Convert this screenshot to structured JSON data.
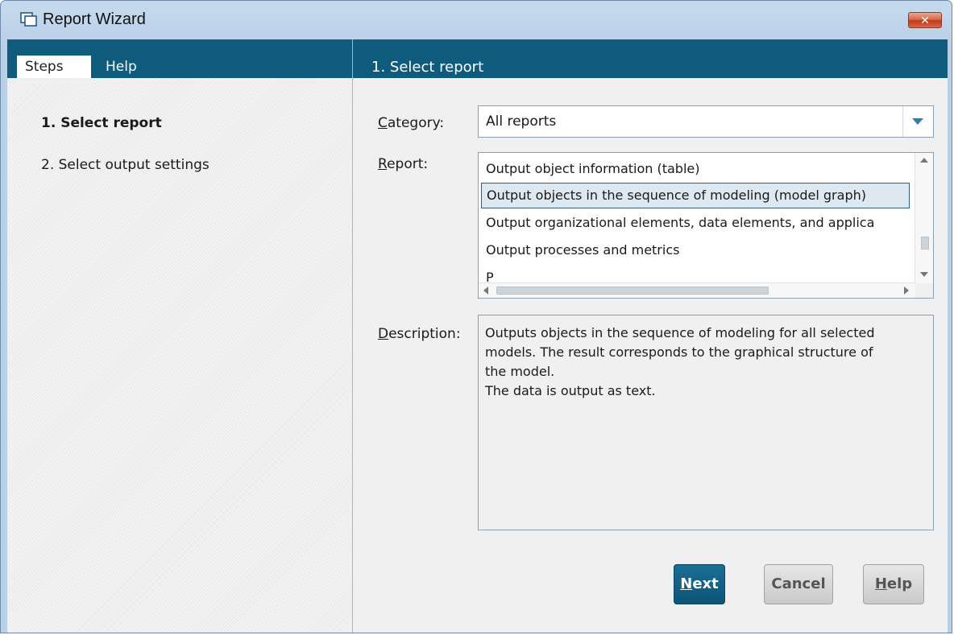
{
  "window": {
    "title": "Report Wizard",
    "close_symbol": "✕",
    "icon": "window-icon"
  },
  "left_panel": {
    "tabs": [
      {
        "label": "Steps",
        "active": true
      },
      {
        "label": "Help",
        "active": false
      }
    ],
    "steps": [
      {
        "label": "1. Select report",
        "active": true
      },
      {
        "label": "2. Select output settings",
        "active": false
      }
    ]
  },
  "right_panel": {
    "header": "1. Select report",
    "category": {
      "label_mnemonic": "C",
      "label_rest": "ategory:",
      "value": "All reports"
    },
    "report": {
      "label_mnemonic": "R",
      "label_rest": "eport:",
      "items": [
        "Output object information (table)",
        "Output objects in the sequence of modeling (model graph)",
        "Output organizational elements, data elements, and applica",
        "Output processes and metrics",
        "P"
      ],
      "selected_index": 1
    },
    "description": {
      "label_mnemonic": "D",
      "label_rest": "escription:",
      "text": "Outputs objects in the sequence of modeling for all selected\nmodels. The result corresponds to the graphical structure of\nthe model.\nThe data is output as text."
    }
  },
  "buttons": {
    "next": {
      "mnemonic": "N",
      "rest": "ext"
    },
    "cancel": {
      "label": "Cancel"
    },
    "help": {
      "mnemonic": "H",
      "rest": "elp"
    }
  },
  "colors": {
    "header_bg": "#0e5b7d",
    "primary_button": "#0c5478",
    "selected_item_border": "#2f5e83"
  }
}
